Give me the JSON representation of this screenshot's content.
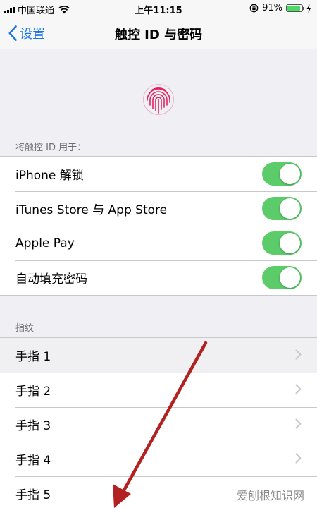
{
  "status_bar": {
    "carrier": "中国联通",
    "time": "上午11:15",
    "battery": "91%",
    "icons": [
      "signal-icon",
      "wifi-icon",
      "rotation-lock-icon",
      "battery-icon",
      "charging-icon"
    ]
  },
  "nav": {
    "back_label": "设置",
    "title": "触控 ID 与密码"
  },
  "touch_id_section": {
    "header": "将触控 ID 用于：",
    "items": [
      {
        "label": "iPhone 解锁",
        "enabled": true
      },
      {
        "label": "iTunes Store 与 App Store",
        "enabled": true
      },
      {
        "label": "Apple Pay",
        "enabled": true
      },
      {
        "label": "自动填充密码",
        "enabled": true
      }
    ]
  },
  "fingerprints_section": {
    "header": "指纹",
    "items": [
      {
        "label": "手指 1"
      },
      {
        "label": "手指 2"
      },
      {
        "label": "手指 3"
      },
      {
        "label": "手指 4"
      },
      {
        "label": "手指 5"
      }
    ]
  },
  "watermark": "爱刨根知识网",
  "colors": {
    "accent": "#1a73e8",
    "toggle_on": "#5ccc6a",
    "fingerprint": "#e0245e",
    "annotation_arrow": "#b22222",
    "background": "#efeff4"
  }
}
